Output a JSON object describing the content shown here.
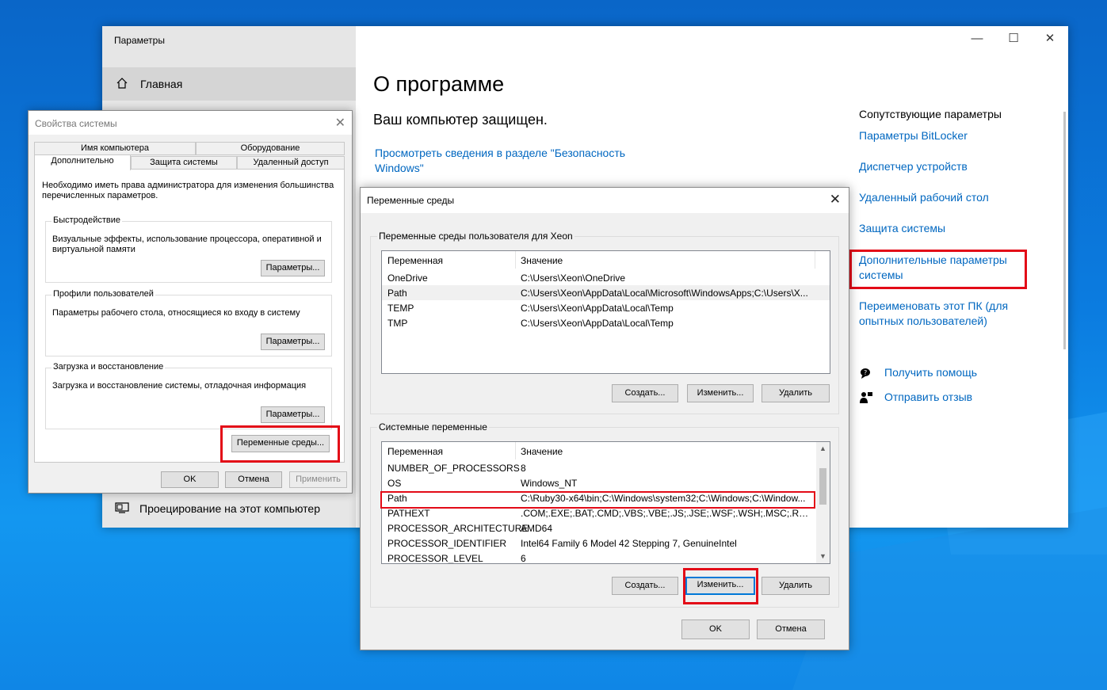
{
  "settings": {
    "title": "Параметры",
    "home_label": "Главная",
    "projection_label": "Проецирование на этот компьютер",
    "heading": "О программе",
    "protected_text": "Ваш компьютер защищен.",
    "security_link": "Просмотреть сведения в разделе \"Безопасность Windows\"",
    "related_heading": "Сопутствующие параметры",
    "related_links": [
      "Параметры BitLocker",
      "Диспетчер устройств",
      "Удаленный рабочий стол",
      "Защита системы",
      "Дополнительные параметры системы",
      "Переименовать этот ПК (для опытных пользователей)"
    ],
    "help_links": [
      "Получить помощь",
      "Отправить отзыв"
    ],
    "window_controls": [
      "—",
      "☐",
      "✕"
    ]
  },
  "sysprop": {
    "title": "Свойства системы",
    "tabs_top": [
      "Имя компьютера",
      "Оборудование"
    ],
    "tabs_bottom": [
      "Дополнительно",
      "Защита системы",
      "Удаленный доступ"
    ],
    "note": "Необходимо иметь права администратора для изменения большинства перечисленных параметров.",
    "groups": [
      {
        "title": "Быстродействие",
        "desc": "Визуальные эффекты, использование процессора, оперативной и виртуальной памяти",
        "button": "Параметры..."
      },
      {
        "title": "Профили пользователей",
        "desc": "Параметры рабочего стола, относящиеся ко входу в систему",
        "button": "Параметры..."
      },
      {
        "title": "Загрузка и восстановление",
        "desc": "Загрузка и восстановление системы, отладочная информация",
        "button": "Параметры..."
      }
    ],
    "env_button": "Переменные среды...",
    "ok": "OK",
    "cancel": "Отмена",
    "apply": "Применить"
  },
  "envvars": {
    "title": "Переменные среды",
    "user_group_title": "Переменные среды пользователя для Xeon",
    "system_group_title": "Системные переменные",
    "col_var": "Переменная",
    "col_val": "Значение",
    "user_vars": [
      {
        "name": "OneDrive",
        "value": "C:\\Users\\Xeon\\OneDrive"
      },
      {
        "name": "Path",
        "value": "C:\\Users\\Xeon\\AppData\\Local\\Microsoft\\WindowsApps;C:\\Users\\X..."
      },
      {
        "name": "TEMP",
        "value": "C:\\Users\\Xeon\\AppData\\Local\\Temp"
      },
      {
        "name": "TMP",
        "value": "C:\\Users\\Xeon\\AppData\\Local\\Temp"
      }
    ],
    "system_vars": [
      {
        "name": "NUMBER_OF_PROCESSORS",
        "value": "8"
      },
      {
        "name": "OS",
        "value": "Windows_NT"
      },
      {
        "name": "Path",
        "value": "C:\\Ruby30-x64\\bin;C:\\Windows\\system32;C:\\Windows;C:\\Window..."
      },
      {
        "name": "PATHEXT",
        "value": ".COM;.EXE;.BAT;.CMD;.VBS;.VBE;.JS;.JSE;.WSF;.WSH;.MSC;.RB;.RBW"
      },
      {
        "name": "PROCESSOR_ARCHITECTURE",
        "value": "AMD64"
      },
      {
        "name": "PROCESSOR_IDENTIFIER",
        "value": "Intel64 Family 6 Model 42 Stepping 7, GenuineIntel"
      },
      {
        "name": "PROCESSOR_LEVEL",
        "value": "6"
      }
    ],
    "create": "Создать...",
    "edit": "Изменить...",
    "delete": "Удалить",
    "ok": "OK",
    "cancel": "Отмена"
  },
  "colors": {
    "highlight_red": "#e30b17",
    "link_blue": "#0067c0",
    "focus_blue": "#0078d7"
  }
}
